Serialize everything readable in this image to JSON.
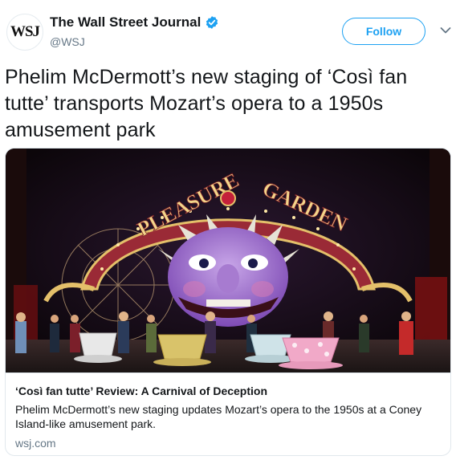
{
  "header": {
    "avatar_text": "WSJ",
    "name": "The Wall Street Journal",
    "handle": "@WSJ",
    "verified_icon": "verified-badge-icon",
    "follow_label": "Follow",
    "menu_icon": "chevron-down-icon"
  },
  "tweet": {
    "text": "Phelim McDermott’s new staging of ‘Così fan tutte’ transports Mozart’s opera to a 1950s amusement park"
  },
  "card": {
    "image_signs": {
      "left": "PLEASURE",
      "right": "GARDEN"
    },
    "title": "‘Così fan tutte’ Review: A Carnival of Deception",
    "description": "Phelim McDermott’s new staging updates Mozart’s opera to the 1950s at a Coney Island-like amusement park.",
    "domain": "wsj.com"
  },
  "colors": {
    "accent": "#1da1f2",
    "text": "#14171a",
    "muted": "#657786",
    "border": "#e1e8ed"
  }
}
